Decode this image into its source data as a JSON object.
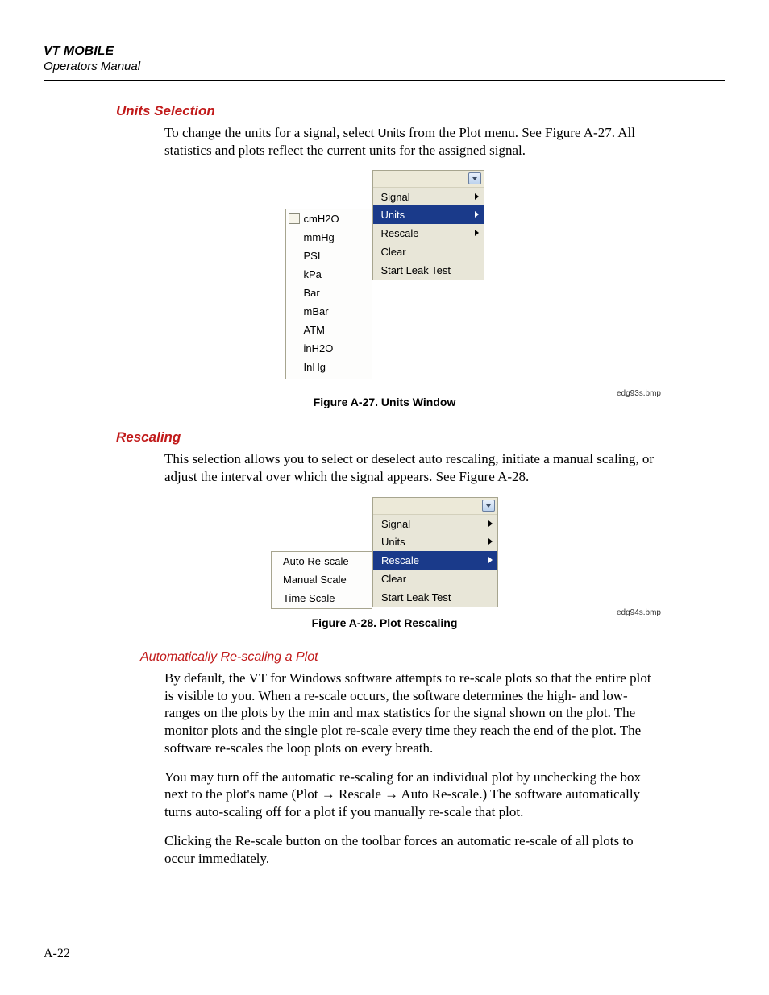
{
  "header": {
    "product": "VT MOBILE",
    "subtitle": "Operators Manual"
  },
  "pageNumber": "A-22",
  "sections": {
    "unitsSelection": {
      "heading": "Units Selection",
      "para_pre": "To change the units for a signal, select ",
      "para_sans": "Units",
      "para_post": " from the Plot menu. See Figure A-27. All statistics and plots reflect the current units for the assigned signal."
    },
    "rescaling": {
      "heading": "Rescaling",
      "para": "This selection allows you to select or deselect auto rescaling, initiate a manual scaling, or adjust the interval over which the signal appears. See Figure A-28."
    },
    "autoRescale": {
      "heading": "Automatically Re-scaling a Plot",
      "para1": "By default, the VT for Windows software attempts to re-scale plots so that the entire plot is visible to you. When a re-scale occurs, the software determines the high- and low-ranges on the plots by the min and max statistics for the signal shown on the plot. The monitor plots and the single plot re-scale every time they reach the end of the plot. The software re-scales the loop plots on every breath.",
      "para2_a": "You may turn off the automatic re-scaling for an individual plot by unchecking the box next to the plot's name (Plot ",
      "para2_b": " Rescale ",
      "para2_c": " Auto Re-scale.) The software automatically turns auto-scaling off for a plot if you manually re-scale that plot.",
      "para3": "Clicking the Re-scale button on the toolbar forces an automatic re-scale of all plots to occur immediately."
    }
  },
  "arrow": "→",
  "fig27": {
    "caption": "Figure A-27. Units Window",
    "imageLabel": "edg93s.bmp",
    "rightMenu": {
      "signal": "Signal",
      "units": "Units",
      "rescale": "Rescale",
      "clear": "Clear",
      "leak": "Start Leak Test"
    },
    "leftMenu": {
      "i0": "cmH2O",
      "i1": "mmHg",
      "i2": "PSI",
      "i3": "kPa",
      "i4": "Bar",
      "i5": "mBar",
      "i6": "ATM",
      "i7": "inH2O",
      "i8": "InHg"
    }
  },
  "fig28": {
    "caption": "Figure A-28. Plot Rescaling",
    "imageLabel": "edg94s.bmp",
    "rightMenu": {
      "signal": "Signal",
      "units": "Units",
      "rescale": "Rescale",
      "clear": "Clear",
      "leak": "Start Leak Test"
    },
    "leftMenu": {
      "i0": "Auto Re-scale",
      "i1": "Manual Scale",
      "i2": "Time Scale"
    }
  }
}
